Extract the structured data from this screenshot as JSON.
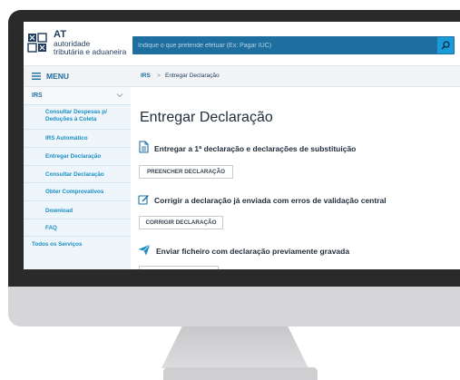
{
  "header": {
    "logo_at": "AT",
    "logo_line1": "autoridade",
    "logo_line2": "tributária e aduaneira",
    "search_placeholder": "Indique o que pretende efetuar (Ex: Pagar IUC)"
  },
  "menu": {
    "label": "MENU"
  },
  "sidebar": {
    "section": "IRS",
    "items": [
      {
        "label_line1": "Consultar Despesas p/",
        "label_line2": "Deduções à Coleta"
      },
      {
        "label": "IRS Automático"
      },
      {
        "label": "Entregar Declaração"
      },
      {
        "label": "Consultar Declaração"
      },
      {
        "label": "Obter Comprovativos"
      },
      {
        "label": "Download"
      },
      {
        "label": "FAQ"
      }
    ],
    "footer_link": "Todos os Serviços"
  },
  "breadcrumb": {
    "home": "IRS",
    "separator": ">",
    "current": "Entregar Declaração"
  },
  "main": {
    "title": "Entregar Declaração",
    "options": [
      {
        "text": "Entregar a 1ª declaração e declarações de substituição",
        "button": "PREENCHER DECLARAÇÃO",
        "icon": "document-icon"
      },
      {
        "text": "Corrigir a declaração já enviada com erros de validação central",
        "button": "CORRIGIR DECLARAÇÃO",
        "icon": "edit-icon"
      },
      {
        "text": "Enviar ficheiro com declaração previamente gravada",
        "button": "",
        "icon": "send-icon"
      }
    ]
  },
  "colors": {
    "brand_dark": "#1e3a5f",
    "link_blue": "#1a8ec2",
    "search_bar": "#1e6f9f",
    "search_button": "#1a9bd7",
    "bezel": "#2a2a2a"
  }
}
